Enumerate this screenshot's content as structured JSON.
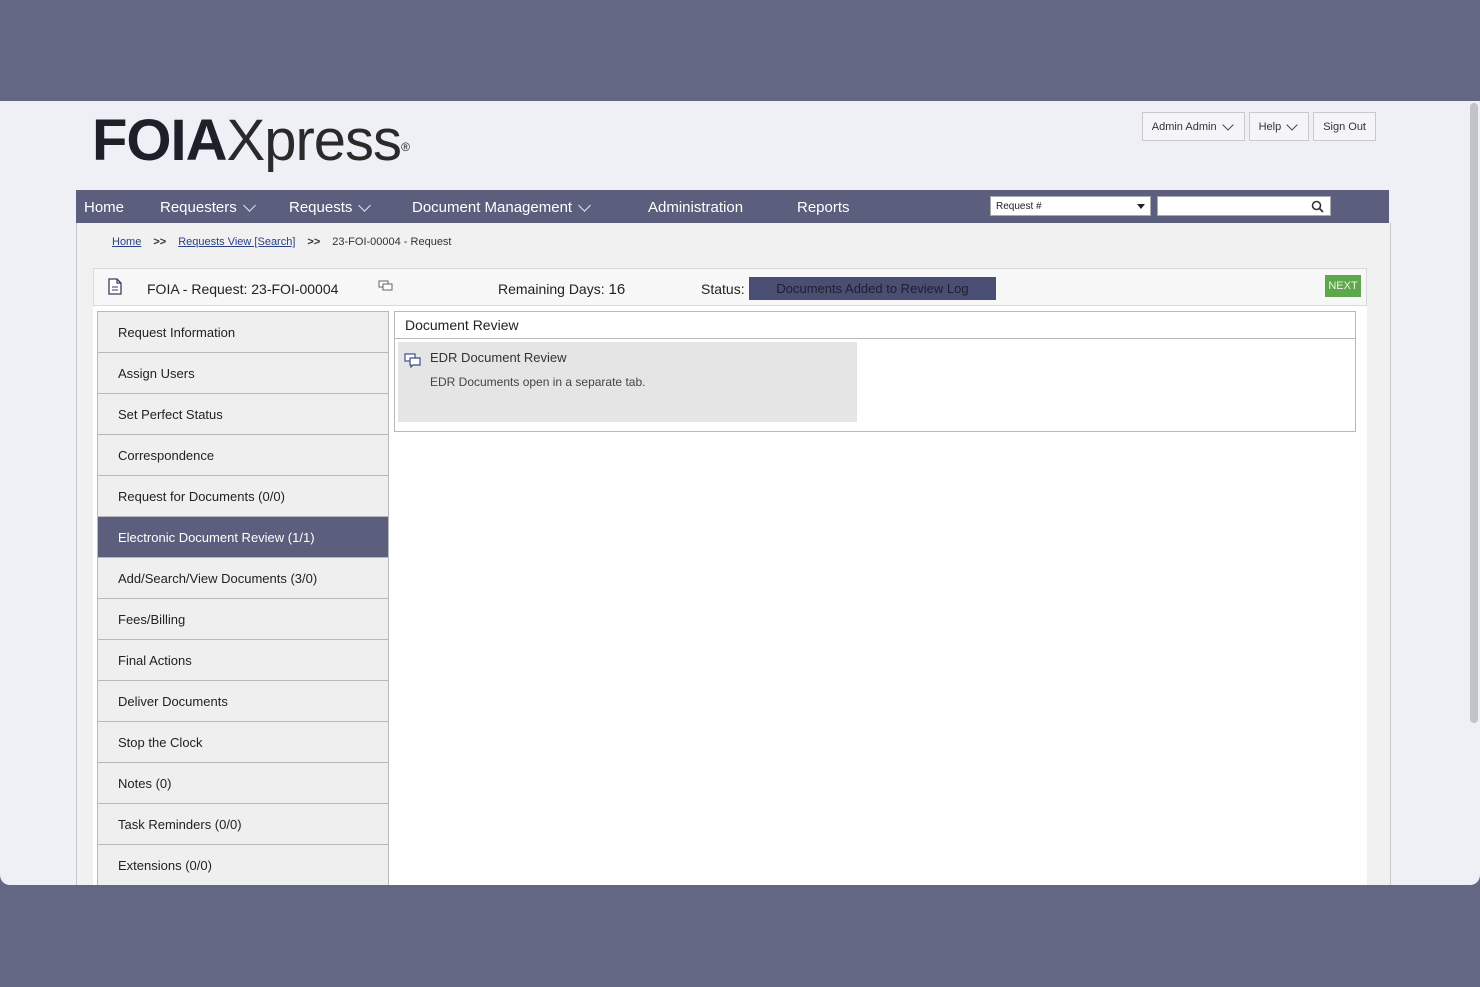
{
  "logo": {
    "bold": "FOIA",
    "regular": "Xpress",
    "reg": "®"
  },
  "user_menu": {
    "user": "Admin Admin",
    "help": "Help",
    "sign_out": "Sign Out"
  },
  "nav": {
    "items": [
      "Home",
      "Requesters",
      "Requests",
      "Document Management",
      "Administration",
      "Reports"
    ],
    "search_select": "Request #",
    "search_value": ""
  },
  "breadcrumb": {
    "home": "Home",
    "sep": ">>",
    "requests_view": "Requests View [Search]",
    "current": "23-FOI-00004 - Request"
  },
  "request_bar": {
    "title": "FOIA - Request: 23-FOI-00004",
    "remaining_label": "Remaining Days:",
    "remaining_value": "16",
    "status_label": "Status:",
    "status_value": "Documents Added to Review Log",
    "next": "NEXT"
  },
  "sidebar": {
    "items": [
      "Request Information",
      "Assign Users",
      "Set Perfect Status",
      "Correspondence",
      "Request for Documents (0/0)",
      "Electronic Document Review (1/1)",
      "Add/Search/View Documents (3/0)",
      "Fees/Billing",
      "Final Actions",
      "Deliver Documents",
      "Stop the Clock",
      "Notes (0)",
      "Task Reminders (0/0)",
      "Extensions (0/0)"
    ],
    "active_index": 5
  },
  "review": {
    "header": "Document Review",
    "card_title": "EDR Document Review",
    "card_subtitle": "EDR Documents open in a separate tab."
  },
  "colors": {
    "nav": "#5c5e7d",
    "status": "#4b4e73",
    "next": "#5da84d",
    "backdrop": "#646784"
  }
}
